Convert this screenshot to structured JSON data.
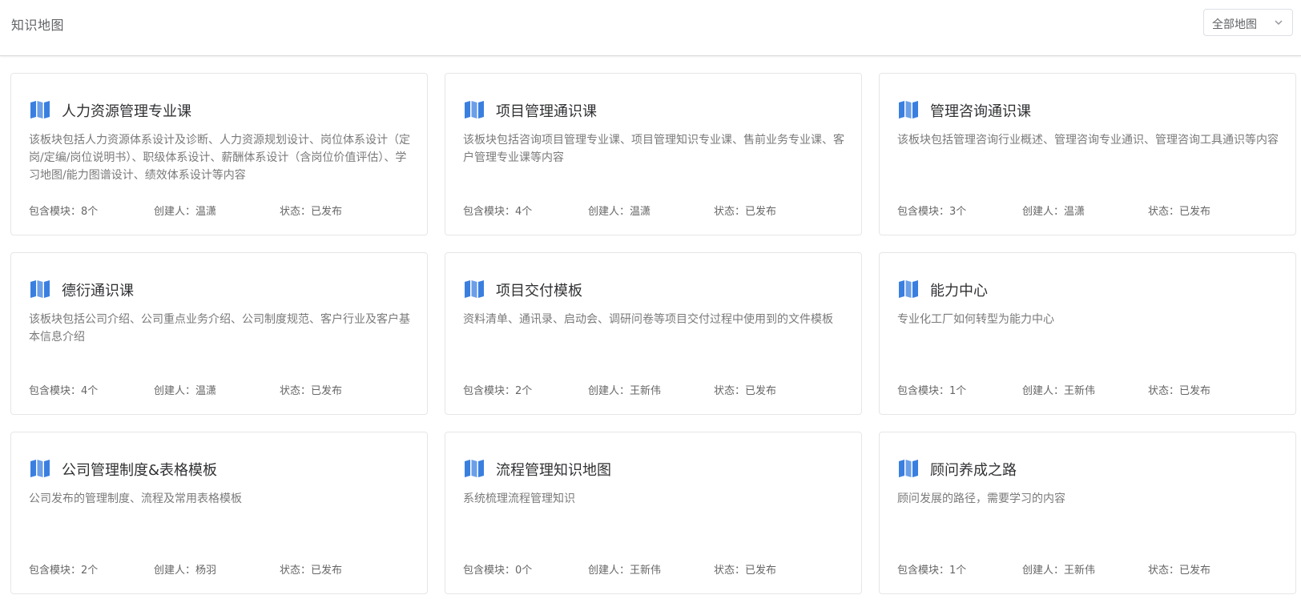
{
  "header": {
    "title": "知识地图",
    "filter": {
      "selected": "全部地图"
    }
  },
  "icons": {
    "card_icon": "map-icon",
    "chevron": "chevron-down-icon",
    "accent_color": "#3a7fe0"
  },
  "cards": [
    {
      "title": "人力资源管理专业课",
      "description": "该板块包括人力资源体系设计及诊断、人力资源规划设计、岗位体系设计（定岗/定编/岗位说明书）、职级体系设计、薪酬体系设计（含岗位价值评估）、学习地图/能力图谱设计、绩效体系设计等内容",
      "modules": "包含模块：8个",
      "creator": "创建人：温潇",
      "status": "状态：已发布"
    },
    {
      "title": "项目管理通识课",
      "description": "该板块包括咨询项目管理专业课、项目管理知识专业课、售前业务专业课、客户管理专业课等内容",
      "modules": "包含模块：4个",
      "creator": "创建人：温潇",
      "status": "状态：已发布"
    },
    {
      "title": "管理咨询通识课",
      "description": "该板块包括管理咨询行业概述、管理咨询专业通识、管理咨询工具通识等内容",
      "modules": "包含模块：3个",
      "creator": "创建人：温潇",
      "status": "状态：已发布"
    },
    {
      "title": "德衍通识课",
      "description": "该板块包括公司介绍、公司重点业务介绍、公司制度规范、客户行业及客户基本信息介绍",
      "modules": "包含模块：4个",
      "creator": "创建人：温潇",
      "status": "状态：已发布"
    },
    {
      "title": "项目交付模板",
      "description": "资料清单、通讯录、启动会、调研问卷等项目交付过程中使用到的文件模板",
      "modules": "包含模块：2个",
      "creator": "创建人：王新伟",
      "status": "状态：已发布"
    },
    {
      "title": "能力中心",
      "description": "专业化工厂如何转型为能力中心",
      "modules": "包含模块：1个",
      "creator": "创建人：王新伟",
      "status": "状态：已发布"
    },
    {
      "title": "公司管理制度&表格模板",
      "description": "公司发布的管理制度、流程及常用表格模板",
      "modules": "包含模块：2个",
      "creator": "创建人：杨羽",
      "status": "状态：已发布"
    },
    {
      "title": "流程管理知识地图",
      "description": "系统梳理流程管理知识",
      "modules": "包含模块：0个",
      "creator": "创建人：王新伟",
      "status": "状态：已发布"
    },
    {
      "title": "顾问养成之路",
      "description": "顾问发展的路径，需要学习的内容",
      "modules": "包含模块：1个",
      "creator": "创建人：王新伟",
      "status": "状态：已发布"
    }
  ]
}
